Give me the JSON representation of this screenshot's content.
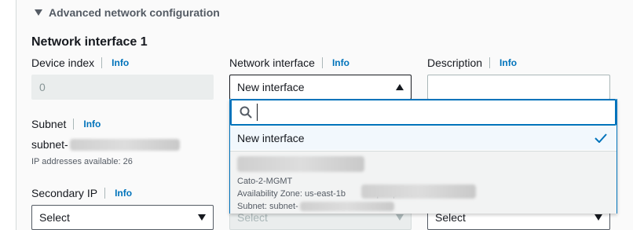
{
  "section": {
    "title": "Advanced network configuration"
  },
  "interface": {
    "heading": "Network interface 1",
    "info_label": "Info",
    "device_index": {
      "label": "Device index",
      "value": "0"
    },
    "network_interface": {
      "label": "Network interface",
      "value": "New interface"
    },
    "description": {
      "label": "Description",
      "value": ""
    },
    "subnet": {
      "label": "Subnet",
      "value_prefix": "subnet-",
      "ip_available": "IP addresses available: 26"
    },
    "secondary_ip": {
      "label": "Secondary IP",
      "value": "Select"
    },
    "col2_select": {
      "value": "Select"
    },
    "col3_select": {
      "value": "Select"
    },
    "col3_hidden_value": "-"
  },
  "dropdown": {
    "search_placeholder": "",
    "options": [
      {
        "label": "New interface",
        "selected": true
      },
      {
        "name": "Cato-2-MGMT",
        "availability_zone": "Availability Zone: us-east-1b",
        "vpc": "vpc-vpc-0eeec5-fa00af1c7",
        "subnet": "Subnet: subnet-"
      }
    ]
  },
  "colors": {
    "accent": "#0073bb",
    "selected_bg": "#f2f8fd",
    "check": "#0073bb"
  }
}
